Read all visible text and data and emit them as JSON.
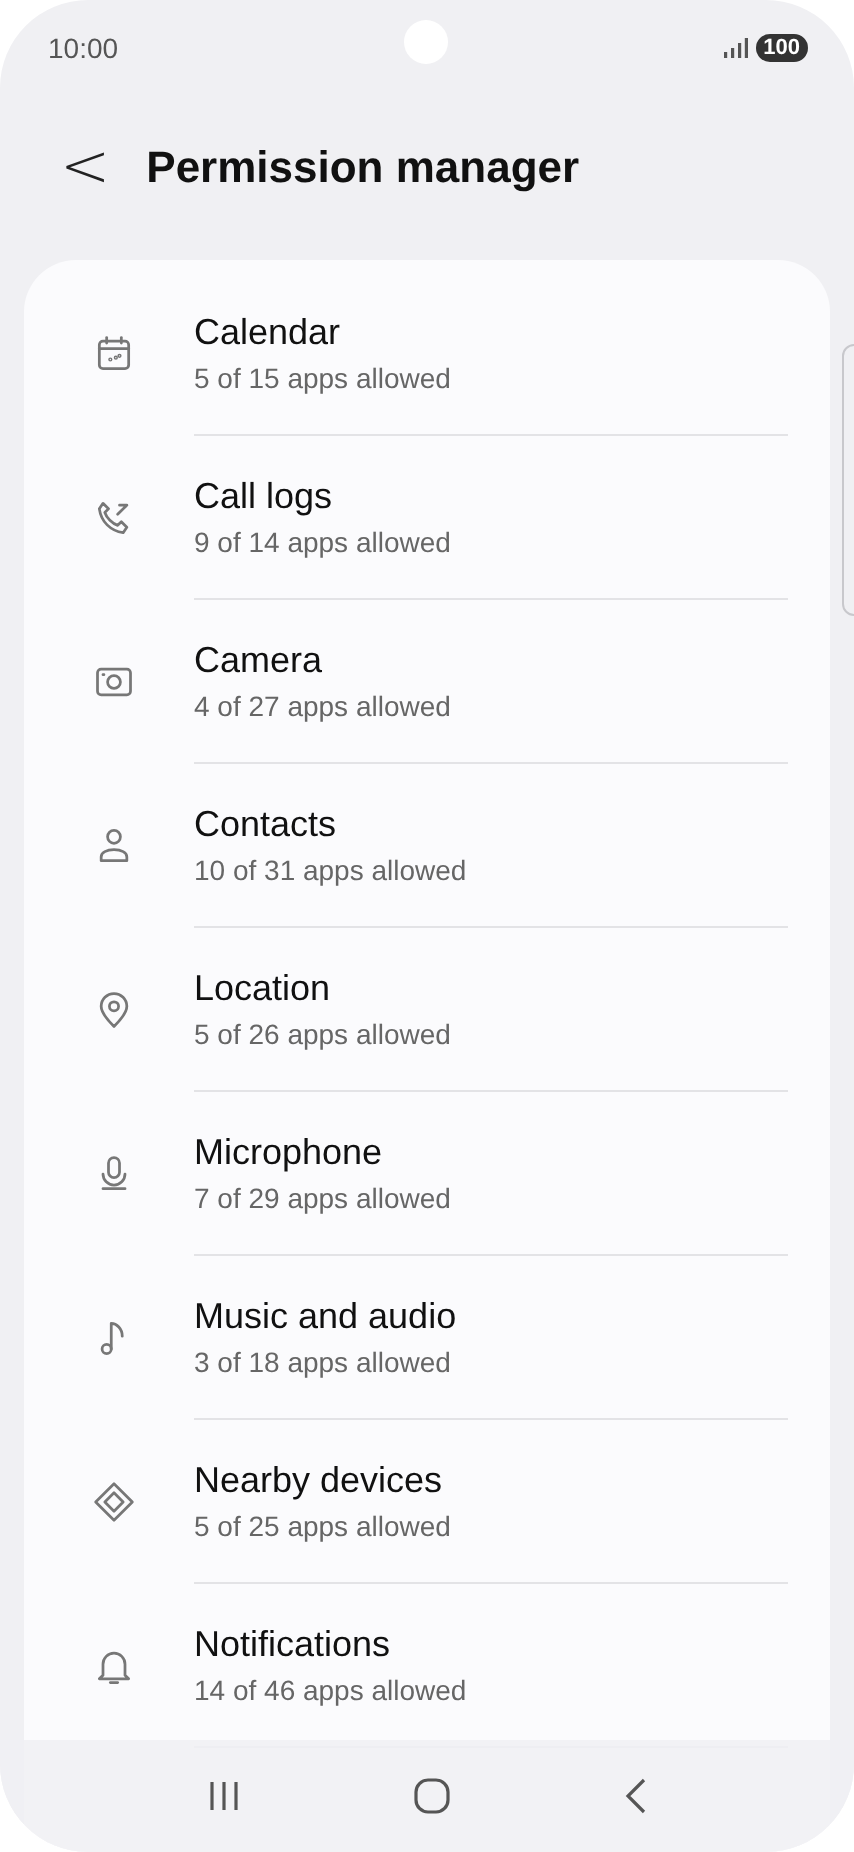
{
  "status_bar": {
    "time": "10:00",
    "battery": "100"
  },
  "header": {
    "back": "<",
    "title": "Permission manager"
  },
  "permissions": [
    {
      "kind": "calendar",
      "title": "Calendar",
      "subtitle": "5 of 15 apps allowed"
    },
    {
      "kind": "call-log",
      "title": "Call logs",
      "subtitle": "9 of 14 apps allowed"
    },
    {
      "kind": "camera",
      "title": "Camera",
      "subtitle": "4 of 27 apps allowed"
    },
    {
      "kind": "person",
      "title": "Contacts",
      "subtitle": "10 of 31 apps allowed"
    },
    {
      "kind": "pin",
      "title": "Location",
      "subtitle": "5 of 26 apps allowed"
    },
    {
      "kind": "mic",
      "title": "Microphone",
      "subtitle": "7 of 29 apps allowed"
    },
    {
      "kind": "note",
      "title": "Music and audio",
      "subtitle": "3 of 18 apps allowed"
    },
    {
      "kind": "diamond",
      "title": "Nearby devices",
      "subtitle": "5 of 25 apps allowed"
    },
    {
      "kind": "bell",
      "title": "Notifications",
      "subtitle": "14 of 46 apps allowed"
    }
  ]
}
